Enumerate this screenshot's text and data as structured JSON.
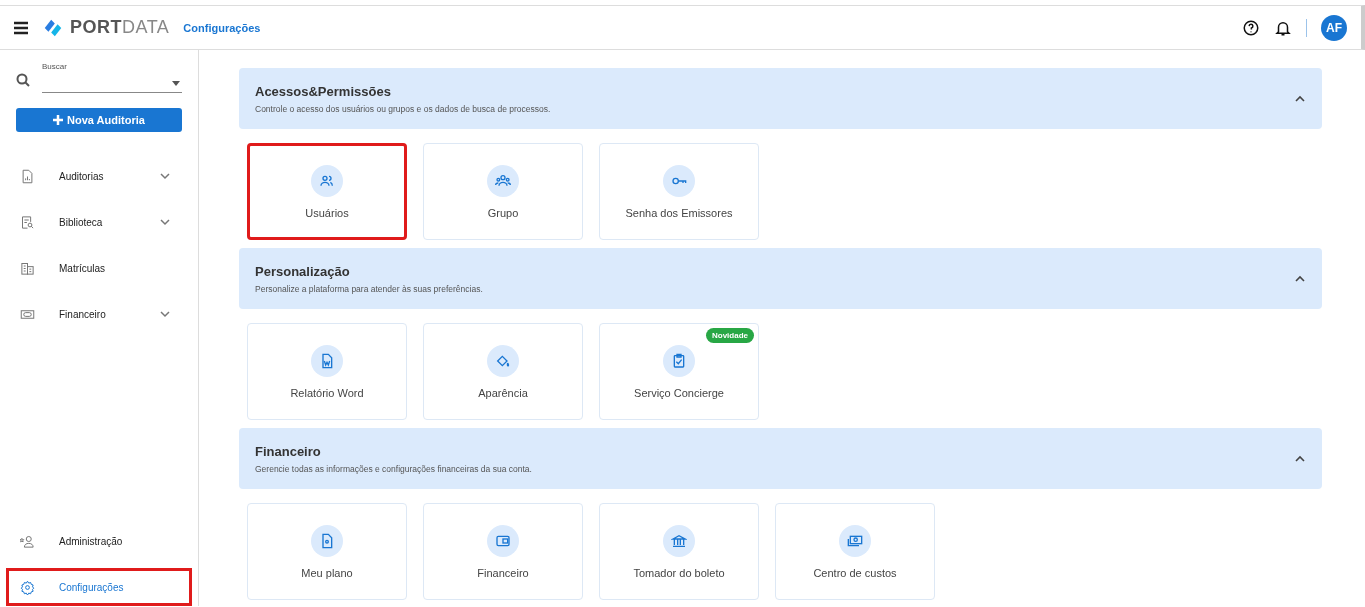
{
  "header": {
    "logo": "**PORT**DATA",
    "page_title": "Configurações",
    "avatar": "AF"
  },
  "sidebar": {
    "search": {
      "label": "Buscar"
    },
    "new_button": "Nova Auditoria",
    "items": [
      {
        "label": "Auditorias",
        "expandable": true,
        "selected": false
      },
      {
        "label": "Biblioteca",
        "expandable": true,
        "selected": false
      },
      {
        "label": "Matrículas",
        "expandable": false,
        "selected": false
      },
      {
        "label": "Financeiro",
        "expandable": true,
        "selected": false
      }
    ],
    "bottom_items": [
      {
        "label": "Administração",
        "selected": false,
        "highlighted": false
      },
      {
        "label": "Configurações",
        "selected": true,
        "highlighted": true
      }
    ]
  },
  "sections": [
    {
      "title": "Acessos&Permissões",
      "description": "Controle o acesso dos usuários ou grupos e os dados de busca de processos.",
      "expanded": true,
      "tiles": [
        {
          "label": "Usuários",
          "highlighted": true
        },
        {
          "label": "Grupo",
          "highlighted": false
        },
        {
          "label": "Senha dos Emissores",
          "highlighted": false
        }
      ]
    },
    {
      "title": "Personalização",
      "description": "Personalize a plataforma para atender às suas preferências.",
      "expanded": true,
      "tiles": [
        {
          "label": "Relatório Word",
          "highlighted": false
        },
        {
          "label": "Aparência",
          "highlighted": false
        },
        {
          "label": "Serviço Concierge",
          "highlighted": false,
          "badge": "Novidade"
        }
      ]
    },
    {
      "title": "Financeiro",
      "description": "Gerencie todas as informações e configurações financeiras da sua conta.",
      "expanded": true,
      "tiles": [
        {
          "label": "Meu plano",
          "highlighted": false
        },
        {
          "label": "Financeiro",
          "highlighted": false
        },
        {
          "label": "Tomador do boleto",
          "highlighted": false
        },
        {
          "label": "Centro de custos",
          "highlighted": false
        }
      ]
    }
  ]
}
